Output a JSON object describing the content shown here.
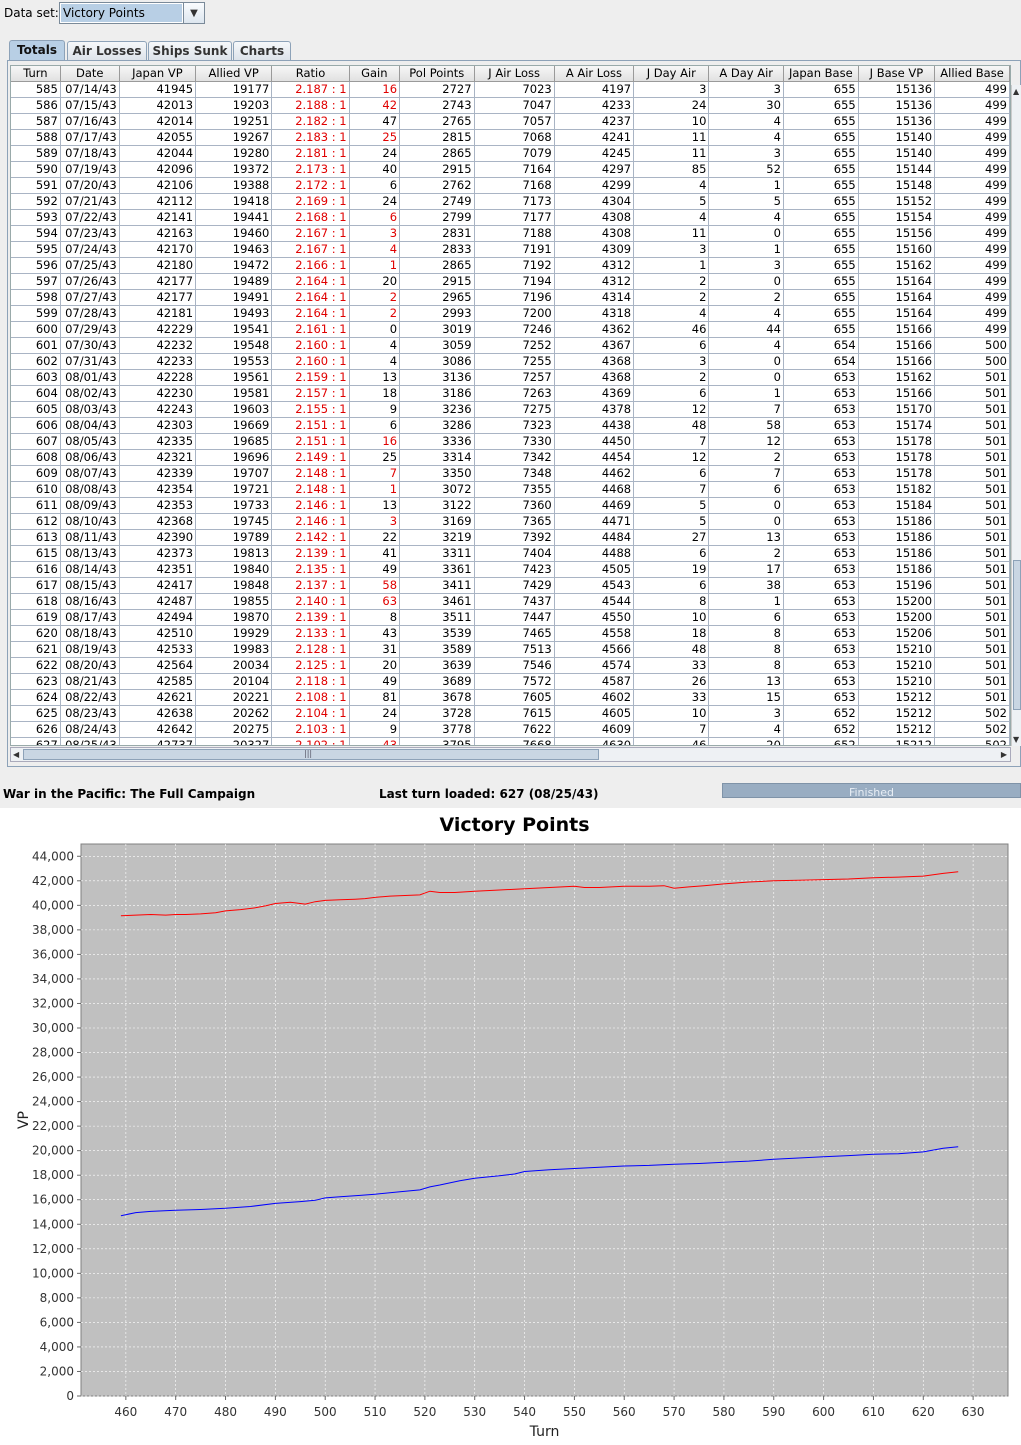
{
  "dataset": {
    "label": "Data set:",
    "value": "Victory Points"
  },
  "tabs": [
    {
      "label": "Totals"
    },
    {
      "label": "Air Losses"
    },
    {
      "label": "Ships Sunk"
    },
    {
      "label": "Charts"
    }
  ],
  "table": {
    "columns": [
      "Turn",
      "Date",
      "Japan VP",
      "Allied VP",
      "Ratio",
      "Gain",
      "Pol Points",
      "J Air Loss",
      "A Air Loss",
      "J Day Air",
      "A Day Air",
      "Japan Base",
      "J Base VP",
      "Allied Base"
    ],
    "partial_row": [
      "585",
      "07/14/43",
      "41945",
      "19177",
      "2.187 : 1",
      "16",
      "2727",
      "7023",
      "4197",
      "3",
      "3",
      "655",
      "15136",
      "499"
    ],
    "rows": [
      [
        "586",
        "07/15/43",
        "42013",
        "19203",
        "2.188 : 1",
        "42",
        "2743",
        "7047",
        "4233",
        "24",
        "30",
        "655",
        "15136",
        "499"
      ],
      [
        "587",
        "07/16/43",
        "42014",
        "19251",
        "2.182 : 1",
        "47",
        "2765",
        "7057",
        "4237",
        "10",
        "4",
        "655",
        "15136",
        "499"
      ],
      [
        "588",
        "07/17/43",
        "42055",
        "19267",
        "2.183 : 1",
        "25",
        "2815",
        "7068",
        "4241",
        "11",
        "4",
        "655",
        "15140",
        "499"
      ],
      [
        "589",
        "07/18/43",
        "42044",
        "19280",
        "2.181 : 1",
        "24",
        "2865",
        "7079",
        "4245",
        "11",
        "3",
        "655",
        "15140",
        "499"
      ],
      [
        "590",
        "07/19/43",
        "42096",
        "19372",
        "2.173 : 1",
        "40",
        "2915",
        "7164",
        "4297",
        "85",
        "52",
        "655",
        "15144",
        "499"
      ],
      [
        "591",
        "07/20/43",
        "42106",
        "19388",
        "2.172 : 1",
        "6",
        "2762",
        "7168",
        "4299",
        "4",
        "1",
        "655",
        "15148",
        "499"
      ],
      [
        "592",
        "07/21/43",
        "42112",
        "19418",
        "2.169 : 1",
        "24",
        "2749",
        "7173",
        "4304",
        "5",
        "5",
        "655",
        "15152",
        "499"
      ],
      [
        "593",
        "07/22/43",
        "42141",
        "19441",
        "2.168 : 1",
        "6",
        "2799",
        "7177",
        "4308",
        "4",
        "4",
        "655",
        "15154",
        "499"
      ],
      [
        "594",
        "07/23/43",
        "42163",
        "19460",
        "2.167 : 1",
        "3",
        "2831",
        "7188",
        "4308",
        "11",
        "0",
        "655",
        "15156",
        "499"
      ],
      [
        "595",
        "07/24/43",
        "42170",
        "19463",
        "2.167 : 1",
        "4",
        "2833",
        "7191",
        "4309",
        "3",
        "1",
        "655",
        "15160",
        "499"
      ],
      [
        "596",
        "07/25/43",
        "42180",
        "19472",
        "2.166 : 1",
        "1",
        "2865",
        "7192",
        "4312",
        "1",
        "3",
        "655",
        "15162",
        "499"
      ],
      [
        "597",
        "07/26/43",
        "42177",
        "19489",
        "2.164 : 1",
        "20",
        "2915",
        "7194",
        "4312",
        "2",
        "0",
        "655",
        "15164",
        "499"
      ],
      [
        "598",
        "07/27/43",
        "42177",
        "19491",
        "2.164 : 1",
        "2",
        "2965",
        "7196",
        "4314",
        "2",
        "2",
        "655",
        "15164",
        "499"
      ],
      [
        "599",
        "07/28/43",
        "42181",
        "19493",
        "2.164 : 1",
        "2",
        "2993",
        "7200",
        "4318",
        "4",
        "4",
        "655",
        "15164",
        "499"
      ],
      [
        "600",
        "07/29/43",
        "42229",
        "19541",
        "2.161 : 1",
        "0",
        "3019",
        "7246",
        "4362",
        "46",
        "44",
        "655",
        "15166",
        "499"
      ],
      [
        "601",
        "07/30/43",
        "42232",
        "19548",
        "2.160 : 1",
        "4",
        "3059",
        "7252",
        "4367",
        "6",
        "4",
        "654",
        "15166",
        "500"
      ],
      [
        "602",
        "07/31/43",
        "42233",
        "19553",
        "2.160 : 1",
        "4",
        "3086",
        "7255",
        "4368",
        "3",
        "0",
        "654",
        "15166",
        "500"
      ],
      [
        "603",
        "08/01/43",
        "42228",
        "19561",
        "2.159 : 1",
        "13",
        "3136",
        "7257",
        "4368",
        "2",
        "0",
        "653",
        "15162",
        "501"
      ],
      [
        "604",
        "08/02/43",
        "42230",
        "19581",
        "2.157 : 1",
        "18",
        "3186",
        "7263",
        "4369",
        "6",
        "1",
        "653",
        "15166",
        "501"
      ],
      [
        "605",
        "08/03/43",
        "42243",
        "19603",
        "2.155 : 1",
        "9",
        "3236",
        "7275",
        "4378",
        "12",
        "7",
        "653",
        "15170",
        "501"
      ],
      [
        "606",
        "08/04/43",
        "42303",
        "19669",
        "2.151 : 1",
        "6",
        "3286",
        "7323",
        "4438",
        "48",
        "58",
        "653",
        "15174",
        "501"
      ],
      [
        "607",
        "08/05/43",
        "42335",
        "19685",
        "2.151 : 1",
        "16",
        "3336",
        "7330",
        "4450",
        "7",
        "12",
        "653",
        "15178",
        "501"
      ],
      [
        "608",
        "08/06/43",
        "42321",
        "19696",
        "2.149 : 1",
        "25",
        "3314",
        "7342",
        "4454",
        "12",
        "2",
        "653",
        "15178",
        "501"
      ],
      [
        "609",
        "08/07/43",
        "42339",
        "19707",
        "2.148 : 1",
        "7",
        "3350",
        "7348",
        "4462",
        "6",
        "7",
        "653",
        "15178",
        "501"
      ],
      [
        "610",
        "08/08/43",
        "42354",
        "19721",
        "2.148 : 1",
        "1",
        "3072",
        "7355",
        "4468",
        "7",
        "6",
        "653",
        "15182",
        "501"
      ],
      [
        "611",
        "08/09/43",
        "42353",
        "19733",
        "2.146 : 1",
        "13",
        "3122",
        "7360",
        "4469",
        "5",
        "0",
        "653",
        "15184",
        "501"
      ],
      [
        "612",
        "08/10/43",
        "42368",
        "19745",
        "2.146 : 1",
        "3",
        "3169",
        "7365",
        "4471",
        "5",
        "0",
        "653",
        "15186",
        "501"
      ],
      [
        "613",
        "08/11/43",
        "42390",
        "19789",
        "2.142 : 1",
        "22",
        "3219",
        "7392",
        "4484",
        "27",
        "13",
        "653",
        "15186",
        "501"
      ],
      [
        "615",
        "08/13/43",
        "42373",
        "19813",
        "2.139 : 1",
        "41",
        "3311",
        "7404",
        "4488",
        "6",
        "2",
        "653",
        "15186",
        "501"
      ],
      [
        "616",
        "08/14/43",
        "42351",
        "19840",
        "2.135 : 1",
        "49",
        "3361",
        "7423",
        "4505",
        "19",
        "17",
        "653",
        "15186",
        "501"
      ],
      [
        "617",
        "08/15/43",
        "42417",
        "19848",
        "2.137 : 1",
        "58",
        "3411",
        "7429",
        "4543",
        "6",
        "38",
        "653",
        "15196",
        "501"
      ],
      [
        "618",
        "08/16/43",
        "42487",
        "19855",
        "2.140 : 1",
        "63",
        "3461",
        "7437",
        "4544",
        "8",
        "1",
        "653",
        "15200",
        "501"
      ],
      [
        "619",
        "08/17/43",
        "42494",
        "19870",
        "2.139 : 1",
        "8",
        "3511",
        "7447",
        "4550",
        "10",
        "6",
        "653",
        "15200",
        "501"
      ],
      [
        "620",
        "08/18/43",
        "42510",
        "19929",
        "2.133 : 1",
        "43",
        "3539",
        "7465",
        "4558",
        "18",
        "8",
        "653",
        "15206",
        "501"
      ],
      [
        "621",
        "08/19/43",
        "42533",
        "19983",
        "2.128 : 1",
        "31",
        "3589",
        "7513",
        "4566",
        "48",
        "8",
        "653",
        "15210",
        "501"
      ],
      [
        "622",
        "08/20/43",
        "42564",
        "20034",
        "2.125 : 1",
        "20",
        "3639",
        "7546",
        "4574",
        "33",
        "8",
        "653",
        "15210",
        "501"
      ],
      [
        "623",
        "08/21/43",
        "42585",
        "20104",
        "2.118 : 1",
        "49",
        "3689",
        "7572",
        "4587",
        "26",
        "13",
        "653",
        "15210",
        "501"
      ],
      [
        "624",
        "08/22/43",
        "42621",
        "20221",
        "2.108 : 1",
        "81",
        "3678",
        "7605",
        "4602",
        "33",
        "15",
        "653",
        "15212",
        "501"
      ],
      [
        "625",
        "08/23/43",
        "42638",
        "20262",
        "2.104 : 1",
        "24",
        "3728",
        "7615",
        "4605",
        "10",
        "3",
        "652",
        "15212",
        "502"
      ],
      [
        "626",
        "08/24/43",
        "42642",
        "20275",
        "2.103 : 1",
        "9",
        "3778",
        "7622",
        "4609",
        "7",
        "4",
        "652",
        "15212",
        "502"
      ],
      [
        "627",
        "08/25/43",
        "42737",
        "20327",
        "2.102 : 1",
        "43",
        "3795",
        "7668",
        "4630",
        "46",
        "20",
        "652",
        "15212",
        "502"
      ]
    ],
    "red_gain_rows": [
      "585",
      "586",
      "588",
      "593",
      "594",
      "595",
      "596",
      "598",
      "599",
      "607",
      "609",
      "610",
      "612",
      "617",
      "618",
      "627"
    ]
  },
  "status": {
    "campaign": "War in the Pacific: The Full Campaign",
    "last_turn": "Last turn loaded: 627 (08/25/43)",
    "progress_label": "Finished"
  },
  "colors": {
    "japan": "#ff0000",
    "allied": "#0000ff",
    "plot_bg": "#c0c0c0",
    "selection": "#b8cfe5",
    "red_text": "#e00000"
  },
  "chart_data": {
    "type": "line",
    "title": "Victory Points",
    "xlabel": "Turn",
    "ylabel": "VP",
    "xlim": [
      451,
      637
    ],
    "ylim": [
      0,
      45000
    ],
    "xticks": [
      460,
      470,
      480,
      490,
      500,
      510,
      520,
      530,
      540,
      550,
      560,
      570,
      580,
      590,
      600,
      610,
      620,
      630
    ],
    "yticks": [
      0,
      2000,
      4000,
      6000,
      8000,
      10000,
      12000,
      14000,
      16000,
      18000,
      20000,
      22000,
      24000,
      26000,
      28000,
      30000,
      32000,
      34000,
      36000,
      38000,
      40000,
      42000,
      44000
    ],
    "grid": true,
    "legend": "none",
    "series": [
      {
        "color": "#ff0000",
        "x": [
          459,
          462,
          465,
          468,
          470,
          472,
          475,
          478,
          480,
          483,
          486,
          488,
          490,
          493,
          496,
          498,
          500,
          503,
          506,
          508,
          510,
          513,
          516,
          519,
          521,
          523,
          526,
          530,
          535,
          540,
          545,
          550,
          552,
          555,
          560,
          565,
          568,
          570,
          573,
          576,
          580,
          585,
          590,
          595,
          600,
          605,
          610,
          615,
          618,
          620,
          624,
          627
        ],
        "y": [
          39150,
          39200,
          39250,
          39200,
          39250,
          39250,
          39300,
          39400,
          39550,
          39650,
          39800,
          39950,
          40150,
          40250,
          40100,
          40300,
          40400,
          40450,
          40500,
          40550,
          40650,
          40750,
          40800,
          40850,
          41150,
          41050,
          41050,
          41150,
          41250,
          41350,
          41450,
          41550,
          41450,
          41450,
          41550,
          41550,
          41600,
          41400,
          41500,
          41600,
          41750,
          41900,
          42000,
          42050,
          42100,
          42150,
          42250,
          42300,
          42350,
          42380,
          42600,
          42737
        ]
      },
      {
        "color": "#0000ff",
        "x": [
          459,
          462,
          465,
          470,
          475,
          480,
          485,
          490,
          495,
          498,
          500,
          503,
          507,
          510,
          515,
          519,
          521,
          523,
          527,
          530,
          535,
          538,
          540,
          545,
          550,
          555,
          560,
          565,
          570,
          575,
          580,
          585,
          590,
          595,
          600,
          605,
          610,
          615,
          620,
          624,
          627
        ],
        "y": [
          14700,
          14950,
          15050,
          15150,
          15200,
          15300,
          15450,
          15700,
          15850,
          15950,
          16150,
          16250,
          16350,
          16450,
          16650,
          16800,
          17050,
          17200,
          17550,
          17750,
          17950,
          18100,
          18300,
          18450,
          18550,
          18650,
          18750,
          18800,
          18900,
          18950,
          19050,
          19150,
          19300,
          19400,
          19500,
          19600,
          19700,
          19750,
          19900,
          20200,
          20327
        ]
      }
    ]
  }
}
